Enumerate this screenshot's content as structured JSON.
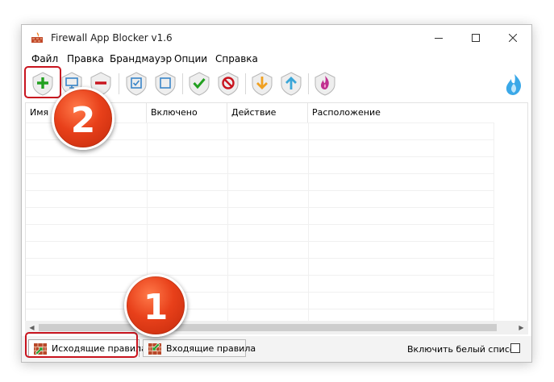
{
  "window": {
    "title": "Firewall App Blocker v1.6"
  },
  "menu": {
    "items": [
      "Файл",
      "Правка",
      "Брандмауэр",
      "Опции",
      "Справка"
    ]
  },
  "toolbar": {
    "buttons": [
      {
        "name": "add",
        "icon": "plus-icon",
        "color": "#22a020"
      },
      {
        "name": "monitor",
        "icon": "monitor-icon",
        "color": "#3a86c8"
      },
      {
        "name": "remove",
        "icon": "minus-icon",
        "color": "#c8141e"
      },
      {
        "name": "check-all",
        "icon": "checkbox-checked-icon",
        "color": "#3a86c8"
      },
      {
        "name": "uncheck-all",
        "icon": "checkbox-empty-icon",
        "color": "#3a86c8"
      },
      {
        "name": "allow",
        "icon": "checkmark-icon",
        "color": "#22a020"
      },
      {
        "name": "block",
        "icon": "block-icon",
        "color": "#c8141e"
      },
      {
        "name": "move-down",
        "icon": "arrow-down-icon",
        "color": "#f0a020"
      },
      {
        "name": "move-up",
        "icon": "arrow-up-icon",
        "color": "#3aa6d8"
      },
      {
        "name": "firewall",
        "icon": "flame-icon",
        "color": "#c03090"
      }
    ]
  },
  "list": {
    "columns": [
      "Имя",
      "Включено",
      "Действие",
      "Расположение"
    ]
  },
  "tabs": {
    "outbound": "Исходящие правила",
    "inbound": "Входящие правила"
  },
  "whitelist": {
    "label": "Включить белый список",
    "checked": false
  },
  "annotations": {
    "step1": "1",
    "step2": "2",
    "highlight_color": "#c8141e"
  }
}
